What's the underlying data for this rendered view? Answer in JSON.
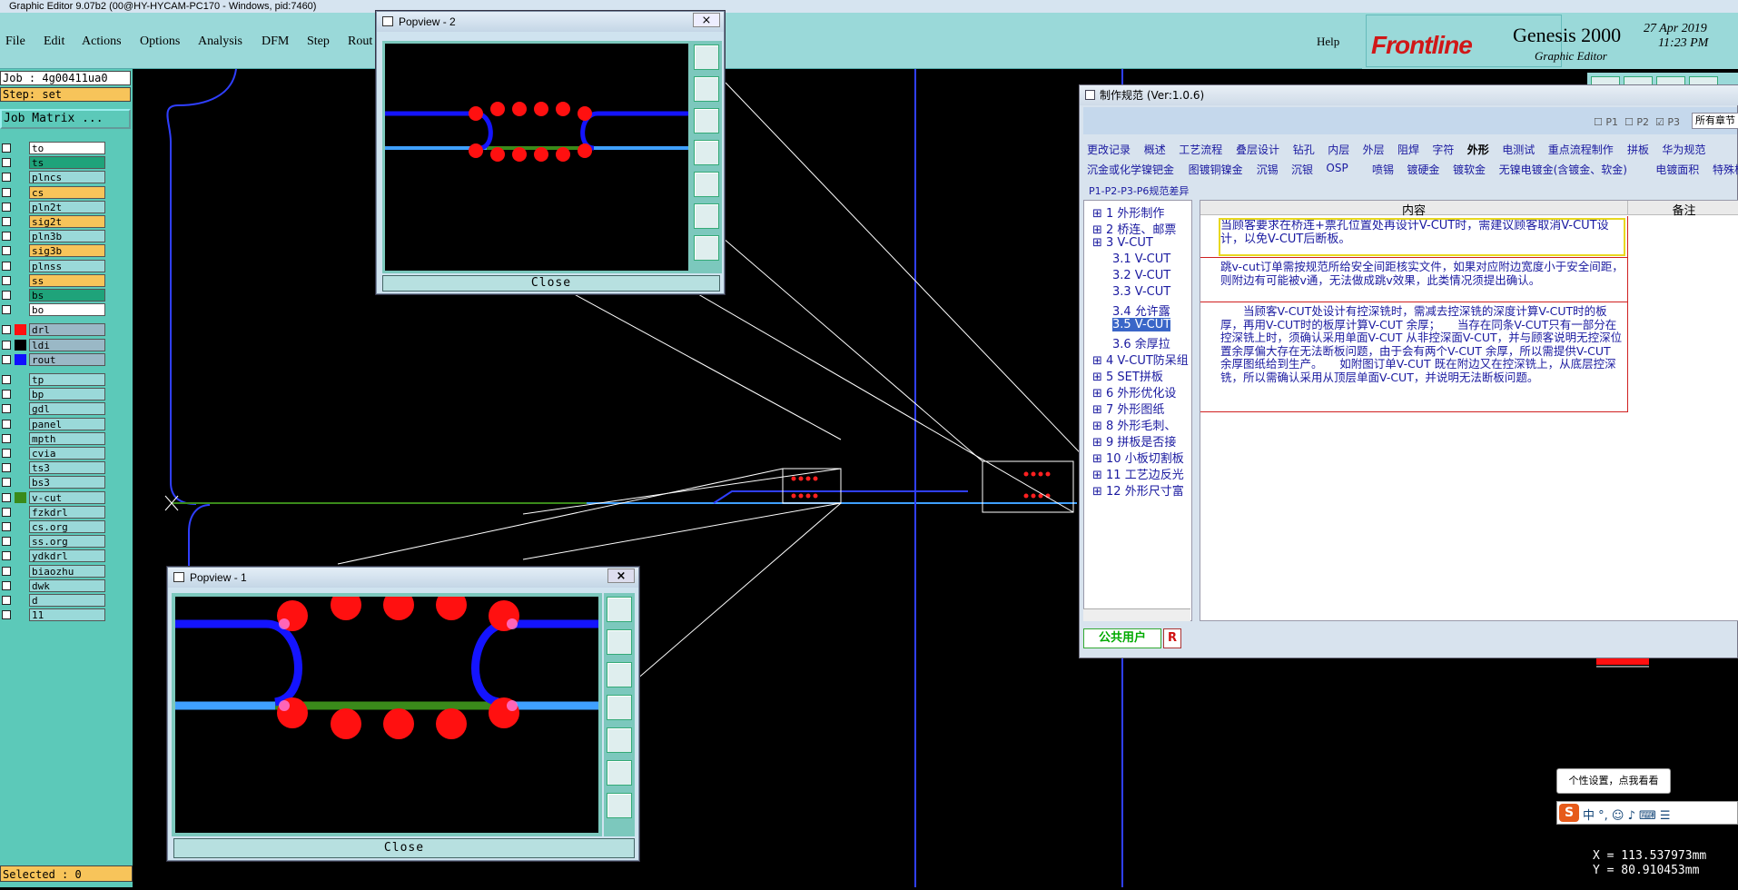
{
  "window_title": "Graphic Editor 9.07b2 (00@HY-HYCAM-PC170 - Windows, pid:7460)",
  "menu": [
    "File",
    "Edit",
    "Actions",
    "Options",
    "Analysis",
    "DFM",
    "Step",
    "Rout"
  ],
  "help": "Help",
  "brand": {
    "logo": "Frontline",
    "product": "Genesis 2000",
    "subtitle": "Graphic Editor",
    "date": "27 Apr 2019",
    "time": "11:23 PM"
  },
  "job": {
    "job_label": "Job : 4g00411ua0",
    "step_label": "Step: set",
    "matrix_button": "Job Matrix ..."
  },
  "layers": [
    {
      "name": "to",
      "color": "#ffffff"
    },
    {
      "name": "ts",
      "color": "#1fa37a"
    },
    {
      "name": "plncs",
      "color": "#9ad9d9"
    },
    {
      "name": "cs",
      "color": "#f7c45a"
    },
    {
      "name": "pln2t",
      "color": "#9ad9d9"
    },
    {
      "name": "sig2t",
      "color": "#f7c45a"
    },
    {
      "name": "pln3b",
      "color": "#9ad9d9"
    },
    {
      "name": "sig3b",
      "color": "#f7c45a"
    },
    {
      "name": "plnss",
      "color": "#9ad9d9"
    },
    {
      "name": "ss",
      "color": "#f7c45a"
    },
    {
      "name": "bs",
      "color": "#1fa37a"
    },
    {
      "name": "bo",
      "color": "#ffffff"
    },
    {
      "name": "drl",
      "color": "#9ab8c6",
      "swatch": "#ff1010"
    },
    {
      "name": "ldi",
      "color": "#9ab8c6",
      "swatch": "#000000"
    },
    {
      "name": "rout",
      "color": "#9ab8c6",
      "swatch": "#1010ff"
    },
    {
      "name": "tp",
      "color": "#9ad9d9"
    },
    {
      "name": "bp",
      "color": "#9ad9d9"
    },
    {
      "name": "gdl",
      "color": "#9ad9d9"
    },
    {
      "name": "panel",
      "color": "#9ad9d9"
    },
    {
      "name": "mpth",
      "color": "#9ad9d9"
    },
    {
      "name": "cvia",
      "color": "#9ad9d9"
    },
    {
      "name": "ts3",
      "color": "#9ad9d9"
    },
    {
      "name": "bs3",
      "color": "#9ad9d9"
    },
    {
      "name": "v-cut",
      "color": "#9ad9d9",
      "swatch": "#3a8a1a"
    },
    {
      "name": "fzkdrl",
      "color": "#9ad9d9"
    },
    {
      "name": "cs.org",
      "color": "#9ad9d9"
    },
    {
      "name": "ss.org",
      "color": "#9ad9d9"
    },
    {
      "name": "ydkdrl",
      "color": "#9ad9d9"
    },
    {
      "name": "biaozhu",
      "color": "#9ad9d9"
    },
    {
      "name": "dwk",
      "color": "#9ad9d9"
    },
    {
      "name": "d",
      "color": "#9ad9d9"
    },
    {
      "name": "11",
      "color": "#9ad9d9"
    }
  ],
  "status": "Selected : 0",
  "coords": {
    "x": "X = 113.537973mm",
    "y": "Y = 80.910453mm"
  },
  "popview1": {
    "title": "Popview - 1",
    "close": "Close"
  },
  "popview2": {
    "title": "Popview - 2",
    "close": "Close"
  },
  "spec": {
    "title": "制作规范 (Ver:1.0.6)",
    "checks": [
      "P1",
      "P2",
      "P3"
    ],
    "all_chapters": "所有章节",
    "tabs_row1": [
      "更改记录",
      "概述",
      "工艺流程",
      "叠层设计",
      "钻孔",
      "内层",
      "外层",
      "阻焊",
      "字符",
      "外形",
      "电测试",
      "重点流程制作",
      "拼板",
      "华为规范"
    ],
    "tabs_row2": [
      "沉金或化学镍钯金",
      "图镀铜镍金",
      "沉锡",
      "沉银",
      "OSP",
      "喷锡",
      "镀硬金",
      "镀软金",
      "无镍电镀金(含镀金、软金)",
      "电镀面积",
      "特殊板"
    ],
    "tabs_row3": "P1-P2-P3-P6规范差异",
    "tree": [
      "1 外形制作",
      "2 桥连、邮票",
      "3 V-CUT",
      "3.1 V-CUT",
      "3.2 V-CUT",
      "3.3 V-CUT",
      "3.4 允许露",
      "3.5 V-CUT",
      "3.6 余厚拉",
      "4 V-CUT防呆组",
      "5 SET拼板",
      "6 外形优化设",
      "7 外形图纸",
      "8 外形毛刺、",
      "9 拼板是否接",
      "10 小板切割板",
      "11 工艺边反光",
      "12 外形尺寸富"
    ],
    "col_content": "内容",
    "col_note": "备注",
    "row1": "当顾客要求在桥连+票孔位置处再设计V-CUT时，需建议顾客取消V-CUT设计，以免V-CUT后断板。",
    "row2": "跳v-cut订单需按规范所给安全间距核实文件，如果对应附边宽度小于安全间距，则附边有可能被v通，无法做成跳v效果，此类情况须提出确认。",
    "row3": "　　当顾客V-CUT处设计有控深铣时，需减去控深铣的深度计算V-CUT时的板厚，再用V-CUT时的板厚计算V-CUT 余厚；　　当存在同条V-CUT只有一部分在控深铣上时，须确认采用单面V-CUT 从非控深面V-CUT，并与顾客说明无控深位置余厚偏大存在无法断板问题，由于会有两个V-CUT 余厚，所以需提供V-CUT 余厚图纸给到生产。　　如附图订单V-CUT 既在附边又在控深铣上，从底层控深铣，所以需确认采用从顶层单面V-CUT，并说明无法断板问题。",
    "footer_user": "公共用户",
    "footer_r": "R"
  },
  "tooltip": "个性设置，点我看看"
}
